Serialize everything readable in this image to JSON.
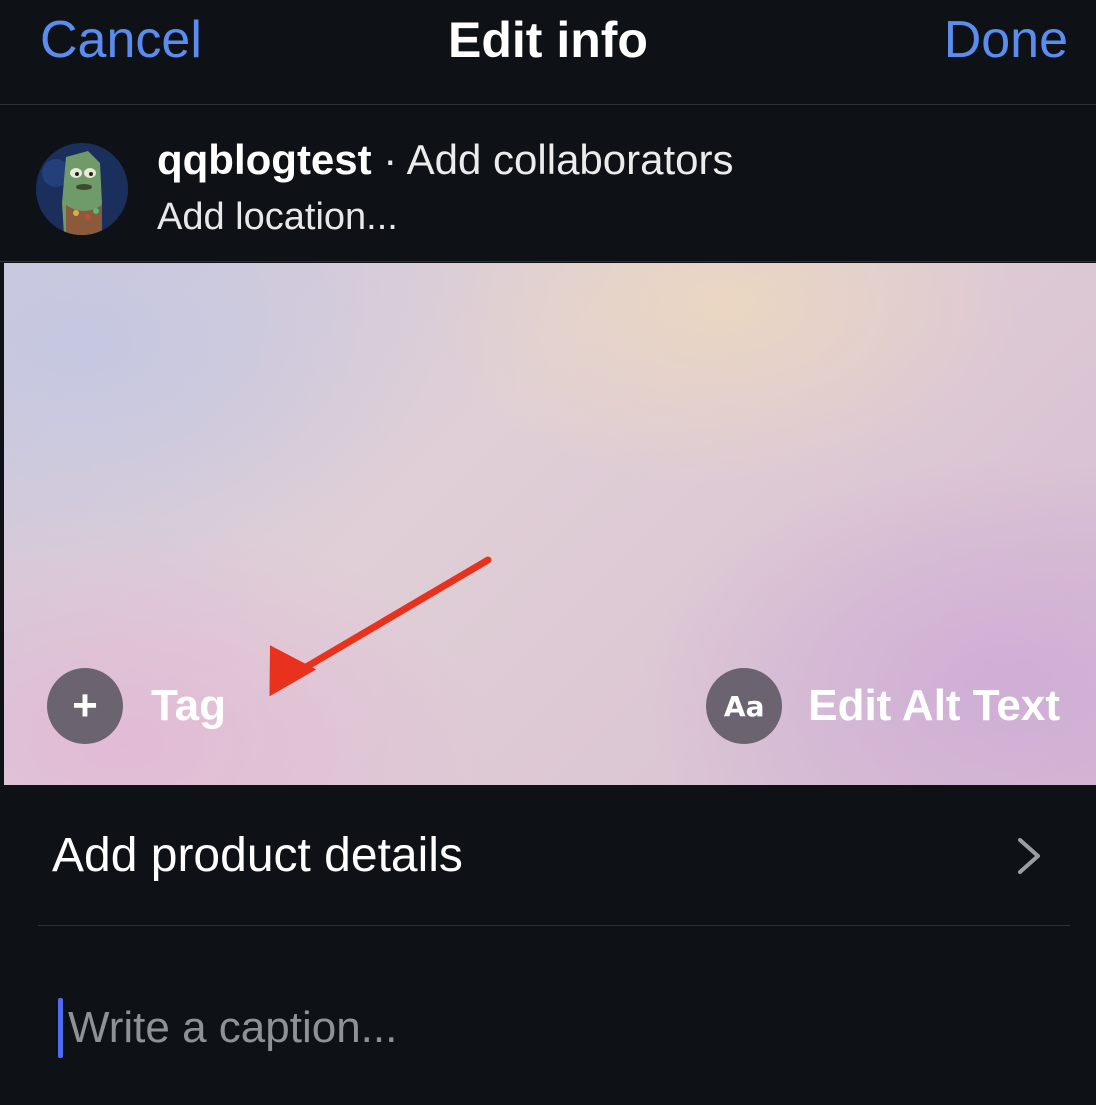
{
  "header": {
    "cancel_label": "Cancel",
    "title": "Edit info",
    "done_label": "Done"
  },
  "author": {
    "username": "qqblogtest",
    "separator": " · ",
    "add_collaborators": "Add collaborators",
    "add_location": "Add location..."
  },
  "photo": {
    "tag_icon": "+",
    "tag_label": "Tag",
    "alt_icon": "Aa",
    "alt_label": "Edit Alt Text"
  },
  "product": {
    "label": "Add product details",
    "chevron_icon": "chevron-right-icon"
  },
  "caption": {
    "placeholder": "Write a caption..."
  },
  "colors": {
    "background": "#0e1217",
    "accent": "#5b8def",
    "annotation_arrow": "#e8321e",
    "cursor": "#4f6cf0"
  }
}
